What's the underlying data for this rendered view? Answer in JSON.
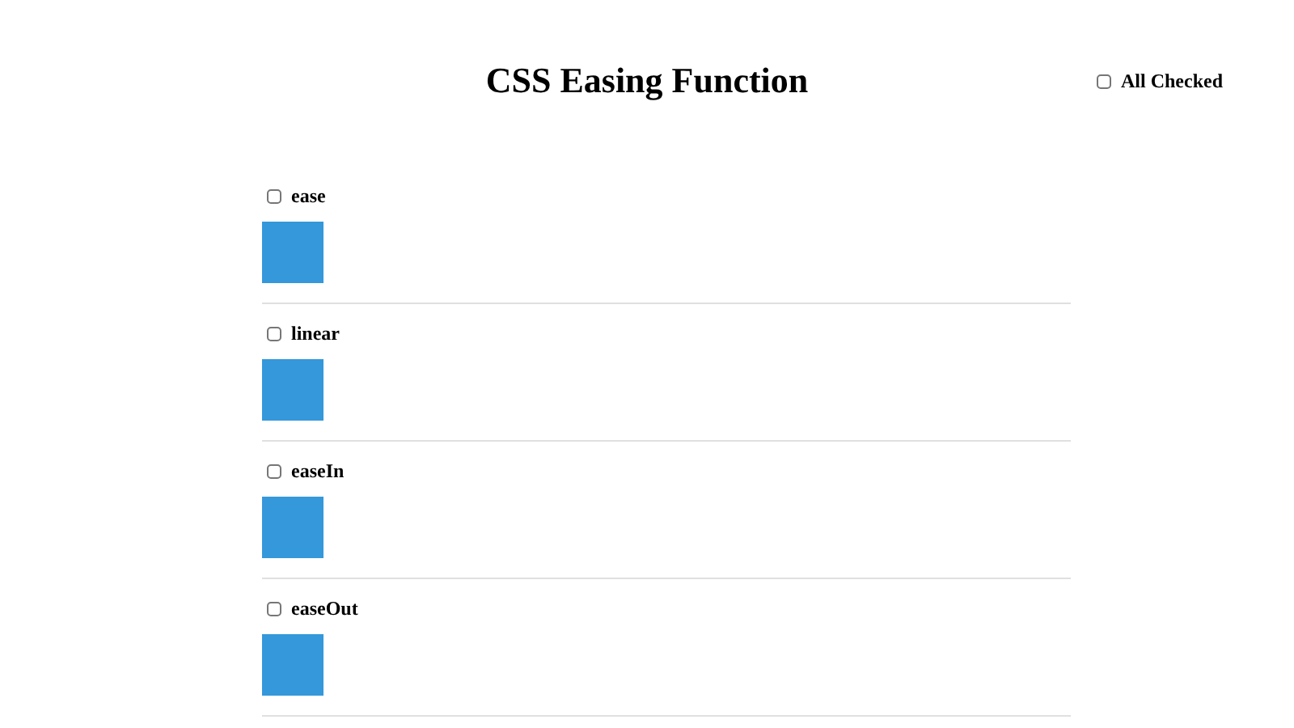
{
  "title": "CSS Easing Function",
  "all_checked": {
    "label": "All Checked",
    "checked": false
  },
  "items": [
    {
      "label": "ease",
      "checked": false
    },
    {
      "label": "linear",
      "checked": false
    },
    {
      "label": "easeIn",
      "checked": false
    },
    {
      "label": "easeOut",
      "checked": false
    }
  ]
}
